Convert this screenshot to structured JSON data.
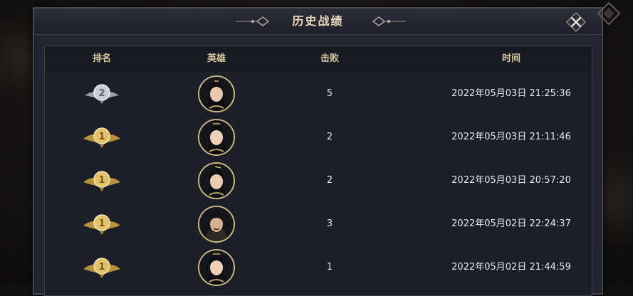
{
  "dialog": {
    "title": "历史战绩"
  },
  "table": {
    "headers": {
      "rank": "排名",
      "hero": "英雄",
      "kills": "击败",
      "time": "时间"
    },
    "rows": [
      {
        "rank": "2",
        "rank_badge": "silver",
        "hero_icon": "female-hero-avatar",
        "kills": "5",
        "time": "2022年05月03日 21:25:36"
      },
      {
        "rank": "1",
        "rank_badge": "gold",
        "hero_icon": "female-hero-avatar",
        "kills": "2",
        "time": "2022年05月03日 21:11:46"
      },
      {
        "rank": "1",
        "rank_badge": "gold",
        "hero_icon": "female-hero-avatar",
        "kills": "2",
        "time": "2022年05月03日 20:57:20"
      },
      {
        "rank": "1",
        "rank_badge": "gold",
        "hero_icon": "male-hero-avatar",
        "kills": "3",
        "time": "2022年05月02日 22:24:37"
      },
      {
        "rank": "1",
        "rank_badge": "gold",
        "hero_icon": "female-hero-avatar",
        "kills": "1",
        "time": "2022年05月02日 21:44:59"
      }
    ]
  },
  "colors": {
    "gold": "#d9b45a",
    "silver": "#c9ced6",
    "header_text": "#d7c7a2",
    "title_text": "#e9dcbf"
  }
}
